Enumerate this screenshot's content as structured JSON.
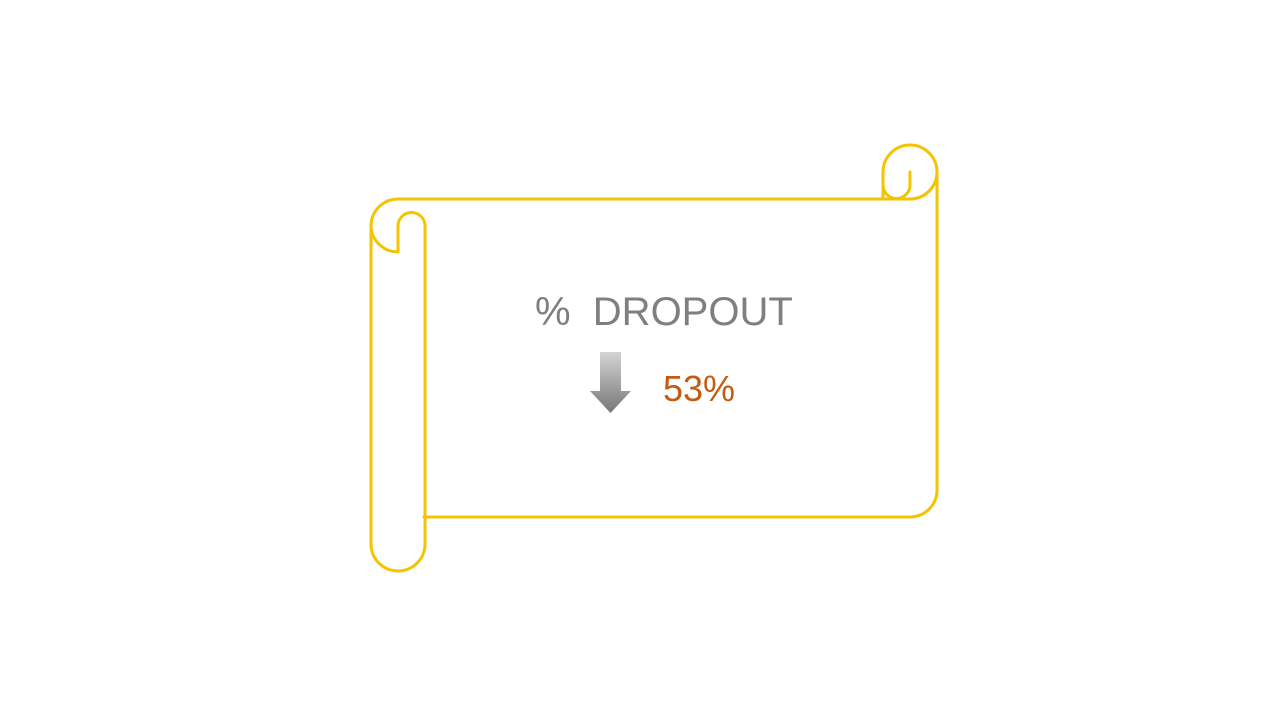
{
  "slide": {
    "title": "%  DROPOUT",
    "value": "53%",
    "trend_icon": "down-arrow-icon",
    "frame_icon": "scroll-icon"
  },
  "colors": {
    "scroll_outline": "#f5c400",
    "title_text": "#7f7f7f",
    "value_text": "#c55a11",
    "arrow_top": "#cfcfcf",
    "arrow_bottom": "#7a7a7a"
  }
}
